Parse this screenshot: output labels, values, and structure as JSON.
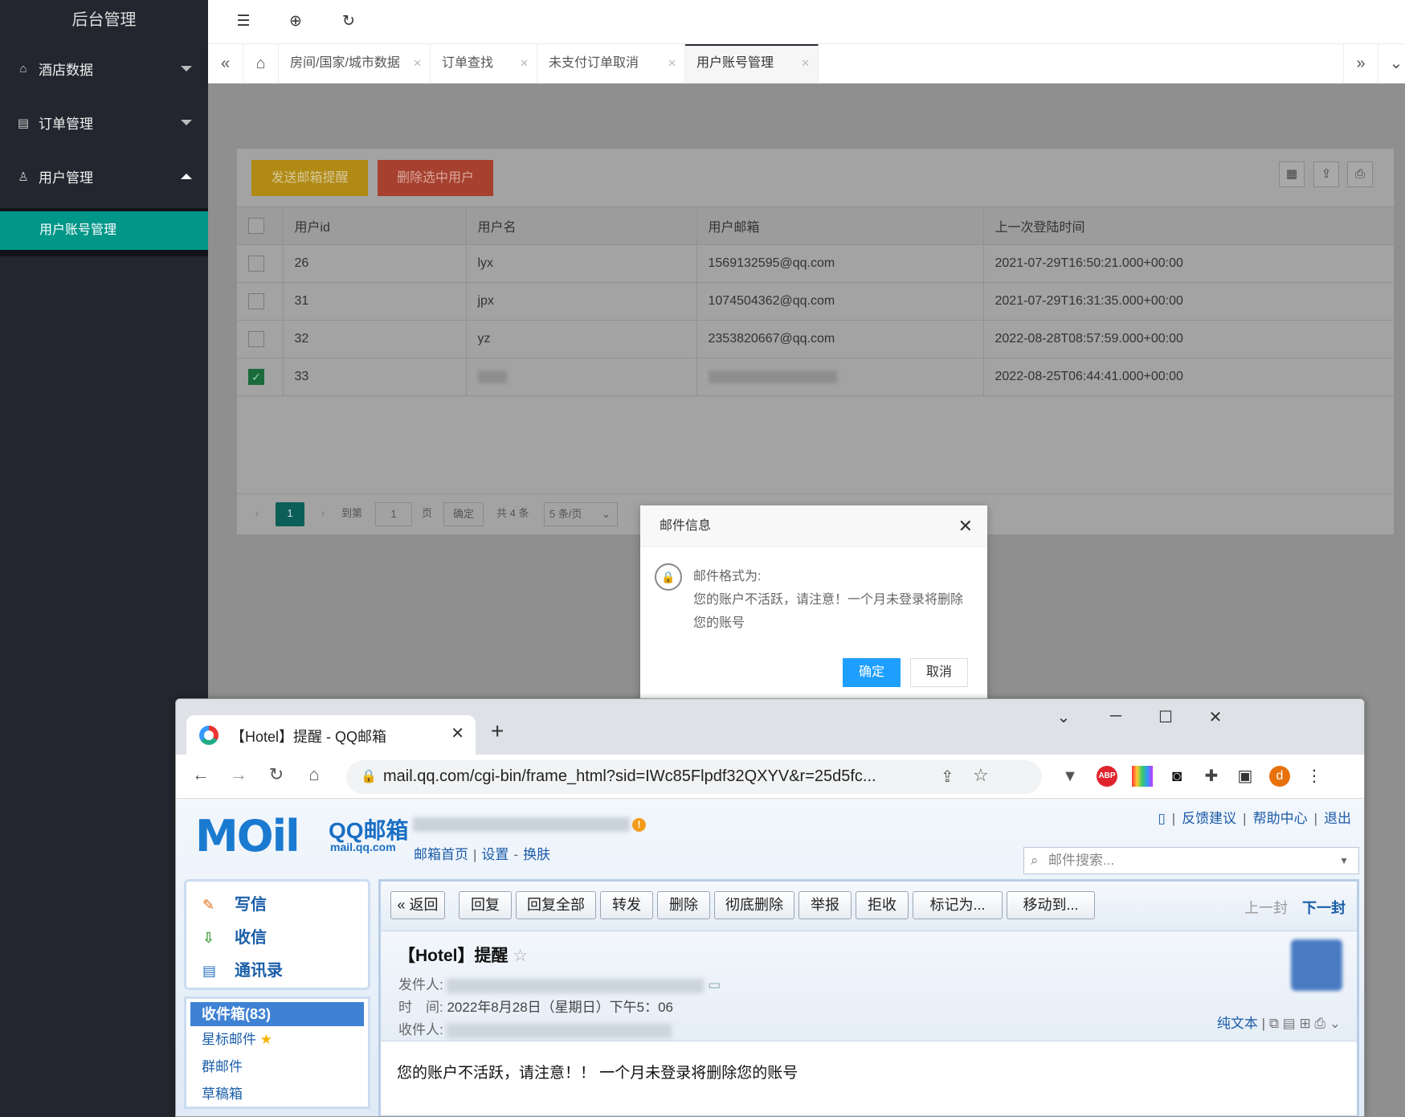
{
  "admin": {
    "brand": "后台管理",
    "menu": [
      {
        "label": "酒店数据",
        "icon": "home-icon",
        "expanded": false
      },
      {
        "label": "订单管理",
        "icon": "list-icon",
        "expanded": false
      },
      {
        "label": "用户管理",
        "icon": "user-icon",
        "expanded": true
      }
    ],
    "submenu_active": "用户账号管理",
    "top_icons": [
      "menu-fold-icon",
      "globe-icon",
      "refresh-icon"
    ],
    "tabs": [
      "房间/国家/城市数据",
      "订单查找",
      "未支付订单取消",
      "用户账号管理"
    ],
    "active_tab": "用户账号管理",
    "buttons": {
      "send_mail": "发送邮箱提醒",
      "delete_selected": "删除选中用户"
    },
    "table": {
      "headers": [
        "用户id",
        "用户名",
        "用户邮箱",
        "上一次登陆时间"
      ],
      "rows": [
        {
          "id": "26",
          "name": "lyx",
          "email": "1569132595@qq.com",
          "last_login": "2021-07-29T16:50:21.000+00:00",
          "checked": false
        },
        {
          "id": "31",
          "name": "jpx",
          "email": "1074504362@qq.com",
          "last_login": "2021-07-29T16:31:35.000+00:00",
          "checked": false
        },
        {
          "id": "32",
          "name": "yz",
          "email": "2353820667@qq.com",
          "last_login": "2022-08-28T08:57:59.000+00:00",
          "checked": false
        },
        {
          "id": "33",
          "name": "",
          "email": "",
          "last_login": "2022-08-25T06:44:41.000+00:00",
          "checked": true
        }
      ]
    },
    "pager": {
      "current": "1",
      "goto_label": "到第",
      "goto_value": "1",
      "page_unit": "页",
      "confirm": "确定",
      "total": "共 4 条",
      "page_size": "5 条/页"
    }
  },
  "dialog": {
    "title": "邮件信息",
    "line1": "邮件格式为:",
    "line2": "您的账户不活跃，请注意！一个月未登录将删除您的账号",
    "ok": "确定",
    "cancel": "取消"
  },
  "browser": {
    "tab_title": "【Hotel】提醒 - QQ邮箱",
    "url": "mail.qq.com/cgi-bin/frame_html?sid=IWc85Flpdf32QXYV&r=25d5fc...",
    "profile_letter": "d"
  },
  "mail": {
    "logo_text": "QQ邮箱",
    "logo_domain": "mail.qq.com",
    "links": [
      "邮箱首页",
      "设置",
      "换肤"
    ],
    "top_links": [
      "反馈建议",
      "帮助中心",
      "退出"
    ],
    "search_placeholder": "邮件搜索...",
    "actions": [
      "写信",
      "收信",
      "通讯录"
    ],
    "folders": {
      "inbox": "收件箱(83)",
      "starred": "星标邮件",
      "group": "群邮件",
      "drafts": "草稿箱"
    },
    "toolbar": [
      "« 返回",
      "回复",
      "回复全部",
      "转发",
      "删除",
      "彻底删除",
      "举报",
      "拒收",
      "标记为...",
      "移动到..."
    ],
    "prev": "上一封",
    "next": "下一封",
    "subject": "【Hotel】提醒",
    "from_label": "发件人:",
    "time_label": "时　间:",
    "time_value": "2022年8月28日（星期日）下午5：06",
    "to_label": "收件人:",
    "plain_text": "纯文本",
    "body": "您的账户不活跃，请注意！！ 一个月未登录将删除您的账号"
  }
}
